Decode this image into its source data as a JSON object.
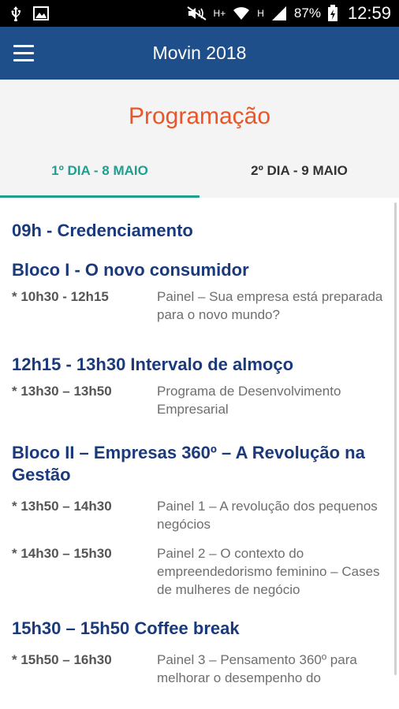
{
  "status_bar": {
    "battery": "87%",
    "time": "12:59",
    "network_h_plus": "H+",
    "network_h": "H"
  },
  "app_bar": {
    "title": "Movin 2018"
  },
  "page": {
    "title": "Programação"
  },
  "tabs": [
    {
      "label": "1º DIA - 8 MAIO",
      "active": true
    },
    {
      "label": "2º DIA - 9 MAIO",
      "active": false
    }
  ],
  "schedule": {
    "credenciamento": "09h - Credenciamento",
    "bloco1": {
      "title": "Bloco I - O novo consumidor",
      "items": [
        {
          "time": "* 10h30 - 12h15",
          "desc": "Painel – Sua empresa está preparada para o novo mundo?"
        }
      ]
    },
    "intervalo": {
      "title": "12h15 - 13h30 Intervalo de almoço",
      "items": [
        {
          "time": "* 13h30 – 13h50",
          "desc": "Programa de Desenvolvimento Empresarial"
        }
      ]
    },
    "bloco2": {
      "title": "Bloco II – Empresas 360º – A Revolução na Gestão",
      "items": [
        {
          "time": "* 13h50 – 14h30",
          "desc": "Painel 1 – A revolução dos pequenos negócios"
        },
        {
          "time": "* 14h30 – 15h30",
          "desc": "Painel 2 – O contexto do empreendedorismo feminino – Cases de mulheres de negócio"
        }
      ]
    },
    "coffee": {
      "title": "15h30 – 15h50 Coffee break",
      "items": [
        {
          "time": "* 15h50 – 16h30",
          "desc": "Painel 3 – Pensamento 360º para melhorar o desempenho do"
        }
      ]
    }
  }
}
